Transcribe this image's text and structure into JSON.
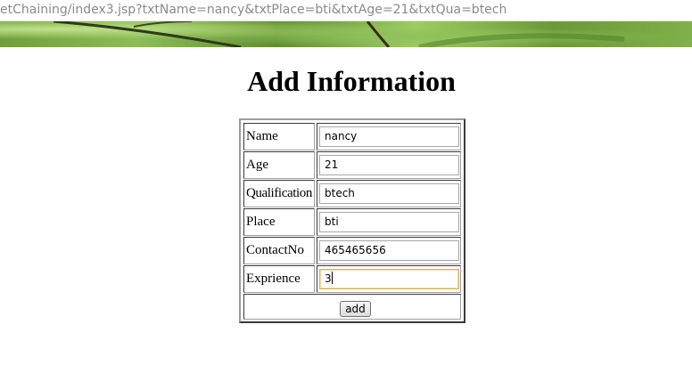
{
  "browser": {
    "url": "etChaining/index3.jsp?txtName=nancy&txtPlace=bti&txtAge=21&txtQua=btech"
  },
  "page": {
    "title": "Add Information"
  },
  "form": {
    "rows": [
      {
        "label": "Name",
        "value": "nancy"
      },
      {
        "label": "Age",
        "value": "21"
      },
      {
        "label": "Qualification",
        "value": "btech"
      },
      {
        "label": "Place",
        "value": "bti"
      },
      {
        "label": "ContactNo",
        "value": "465465656"
      },
      {
        "label": "Exprience",
        "value": "3"
      }
    ],
    "submit_label": "add"
  }
}
